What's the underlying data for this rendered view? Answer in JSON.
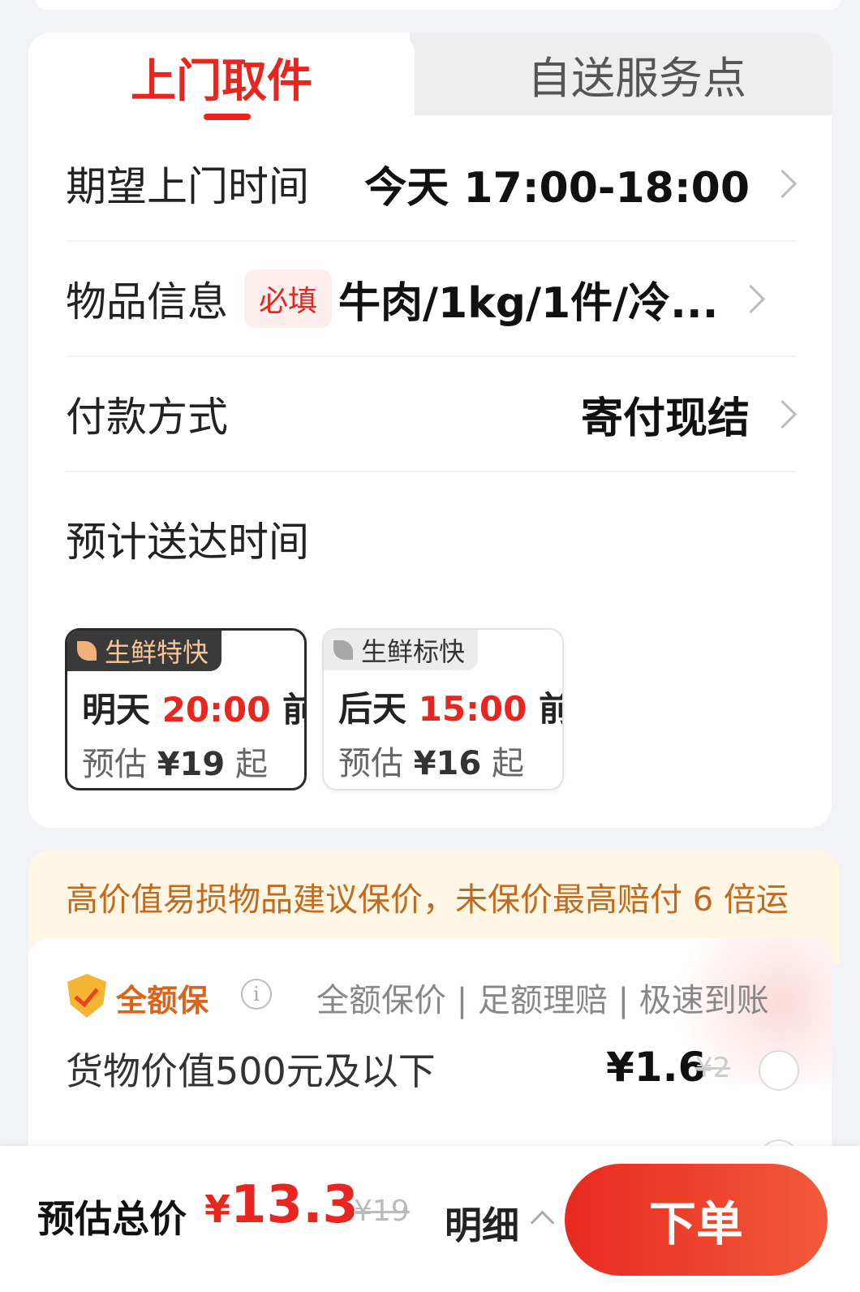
{
  "tabs": {
    "pickup": "上门取件",
    "self_drop": "自送服务点"
  },
  "form": {
    "pickup_time": {
      "label": "期望上门时间",
      "value": "今天 17:00-18:00"
    },
    "item_info": {
      "label": "物品信息",
      "badge": "必填",
      "value": "牛肉/1kg/1件/冷..."
    },
    "payment": {
      "label": "付款方式",
      "value": "寄付现结"
    },
    "delivery_title": "预计送达时间"
  },
  "delivery_options": [
    {
      "tag": "生鲜特快",
      "day": "明天",
      "time": "20:00",
      "suffix": "前",
      "price_prefix": "预估",
      "price": "¥19",
      "price_suffix": "起",
      "selected": true
    },
    {
      "tag": "生鲜标快",
      "day": "后天",
      "time": "15:00",
      "suffix": "前",
      "price_prefix": "预估",
      "price": "¥16",
      "price_suffix": "起",
      "selected": false
    }
  ],
  "notice": "高价值易损物品建议保价，未保价最高赔付 6 倍运",
  "insurance": {
    "name": "全额保",
    "info_icon": "i",
    "features": "全额保价 | 足额理赔 | 极速到账",
    "tier_label": "货物价值500元及以下",
    "tier_price": "¥1.6",
    "tier_original": "¥2"
  },
  "bottom": {
    "total_label": "预估总价",
    "currency": "¥",
    "total": "13.3",
    "original": "¥19",
    "detail": "明细",
    "order_button": "下单"
  },
  "colors": {
    "accent": "#e8251e",
    "notice_text": "#c26a1d",
    "insurance_name": "#d9641a"
  }
}
